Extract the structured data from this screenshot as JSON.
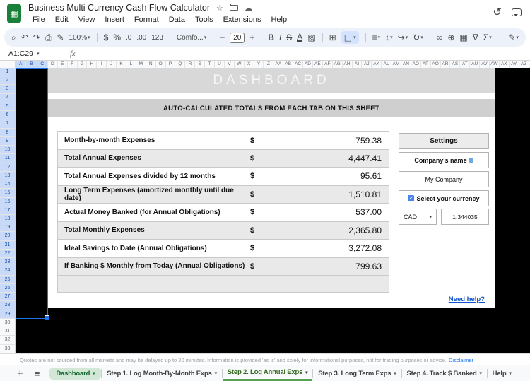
{
  "app": {
    "title": "Business Multi Currency Cash Flow Calculator",
    "menus": [
      "File",
      "Edit",
      "View",
      "Insert",
      "Format",
      "Data",
      "Tools",
      "Extensions",
      "Help"
    ]
  },
  "icons": {
    "search": "⌕",
    "undo": "↶",
    "redo": "↷",
    "print": "⎙",
    "paint_format": "✎",
    "dropdown": "▾",
    "minus": "−",
    "plus": "+",
    "borders": "⊞",
    "merge_cells": "◫",
    "fill_color": "▨",
    "horizontal_align": "≡",
    "vertical_align": "↕",
    "text_wrap": "↪",
    "text_rotation": "↻",
    "insert_link": "∞",
    "insert_comment": "⊕",
    "insert_chart": "▦",
    "create_filter": "∇",
    "functions": "Σ",
    "star": "☆",
    "cloud": "☁",
    "history": "↺",
    "edit_mode": "✎",
    "all_sheets": "≡",
    "add_sheet": "+",
    "check": "✓",
    "logo_grid": "▦"
  },
  "toolbar": {
    "zoom": "100%",
    "currency_format": "$",
    "percent_format": "%",
    "decrease_decimal": ".0",
    "increase_decimal": ".00",
    "more_formats": "123",
    "font_family": "Comfo...",
    "font_size": "20",
    "bold": "B",
    "italic": "I",
    "strikethrough": "S",
    "text_color": "A"
  },
  "formula_bar": {
    "name_box": "A1:C29",
    "fx_label": "fx"
  },
  "grid": {
    "columns": [
      "A",
      "B",
      "C",
      "D",
      "E",
      "F",
      "G",
      "H",
      "I",
      "J",
      "K",
      "L",
      "M",
      "N",
      "O",
      "P",
      "Q",
      "R",
      "S",
      "T",
      "U",
      "V",
      "W",
      "X",
      "Y",
      "Z",
      "AA",
      "AB",
      "AC",
      "AD",
      "AE",
      "AF",
      "AG",
      "AH",
      "AI",
      "AJ",
      "AK",
      "AL",
      "AM",
      "AN",
      "AO",
      "AP",
      "AQ",
      "AR",
      "AS",
      "AT",
      "AU",
      "AV",
      "AW",
      "AX",
      "AY",
      "AZ"
    ],
    "rows": [
      "1",
      "2",
      "3",
      "4",
      "5",
      "6",
      "7",
      "8",
      "9",
      "10",
      "11",
      "12",
      "13",
      "14",
      "15",
      "16",
      "17",
      "18",
      "19",
      "20",
      "21",
      "22",
      "23",
      "24",
      "25",
      "26",
      "27",
      "28",
      "29",
      "30",
      "31",
      "32",
      "33"
    ]
  },
  "dashboard": {
    "title": "DASHBOARD",
    "subtitle": "AUTO-CALCULATED TOTALS FROM EACH TAB ON THIS SHEET",
    "rows": [
      {
        "label": "Month-by-month Expenses",
        "currency": "$",
        "value": "759.38"
      },
      {
        "label": "Total Annual Expenses",
        "currency": "$",
        "value": "4,447.41"
      },
      {
        "label": "Total Annual Expenses divided by 12 months",
        "currency": "$",
        "value": "95.61"
      },
      {
        "label": "Long Term Expenses (amortized monthly until due date)",
        "currency": "$",
        "value": "1,510.81"
      },
      {
        "label": "Actual Money Banked (for Annual Obligations)",
        "currency": "$",
        "value": "537.00"
      },
      {
        "label": "Total Monthly Expenses",
        "currency": "$",
        "value": "2,365.80"
      },
      {
        "label": "Ideal Savings to Date (Annual Obligations)",
        "currency": "$",
        "value": "3,272.08"
      },
      {
        "label": "If Banking $ Monthly from Today (Annual Obligations)",
        "currency": "$",
        "value": "799.63"
      }
    ],
    "settings": {
      "header": "Settings",
      "company_label": "Company's name",
      "company_value": "My Company",
      "currency_label": "Select your currency",
      "currency_code": "CAD",
      "exchange_rate": "1.344035"
    },
    "help_link": "Need help?"
  },
  "footer": {
    "disclaimer": "Quotes are not sourced from all markets and may be delayed up to 20 minutes. Information is provided 'as is' and solely for informational purposes, not for trading purposes or advice.",
    "disclaimer_link": "Disclaimer"
  },
  "sheet_tabs": [
    {
      "label": "Dashboard"
    },
    {
      "label": "Step 1. Log Month-By-Month Exps"
    },
    {
      "label": "Step 2. Log Annual Exps"
    },
    {
      "label": "Step 3. Long Term Exps"
    },
    {
      "label": "Step 4. Track $ Banked"
    },
    {
      "label": "Help"
    }
  ]
}
